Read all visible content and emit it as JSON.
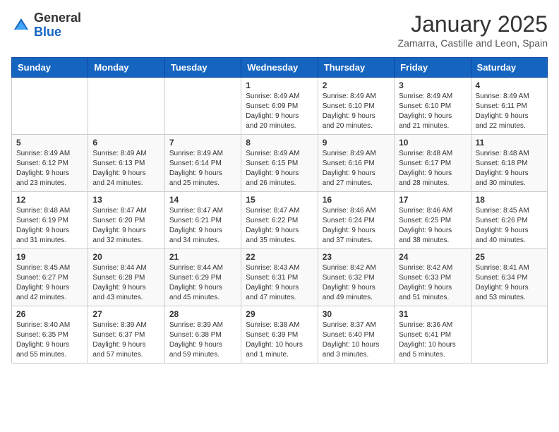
{
  "logo": {
    "general": "General",
    "blue": "Blue"
  },
  "header": {
    "month": "January 2025",
    "location": "Zamarra, Castille and Leon, Spain"
  },
  "weekdays": [
    "Sunday",
    "Monday",
    "Tuesday",
    "Wednesday",
    "Thursday",
    "Friday",
    "Saturday"
  ],
  "weeks": [
    [
      {
        "day": "",
        "info": ""
      },
      {
        "day": "",
        "info": ""
      },
      {
        "day": "",
        "info": ""
      },
      {
        "day": "1",
        "info": "Sunrise: 8:49 AM\nSunset: 6:09 PM\nDaylight: 9 hours\nand 20 minutes."
      },
      {
        "day": "2",
        "info": "Sunrise: 8:49 AM\nSunset: 6:10 PM\nDaylight: 9 hours\nand 20 minutes."
      },
      {
        "day": "3",
        "info": "Sunrise: 8:49 AM\nSunset: 6:10 PM\nDaylight: 9 hours\nand 21 minutes."
      },
      {
        "day": "4",
        "info": "Sunrise: 8:49 AM\nSunset: 6:11 PM\nDaylight: 9 hours\nand 22 minutes."
      }
    ],
    [
      {
        "day": "5",
        "info": "Sunrise: 8:49 AM\nSunset: 6:12 PM\nDaylight: 9 hours\nand 23 minutes."
      },
      {
        "day": "6",
        "info": "Sunrise: 8:49 AM\nSunset: 6:13 PM\nDaylight: 9 hours\nand 24 minutes."
      },
      {
        "day": "7",
        "info": "Sunrise: 8:49 AM\nSunset: 6:14 PM\nDaylight: 9 hours\nand 25 minutes."
      },
      {
        "day": "8",
        "info": "Sunrise: 8:49 AM\nSunset: 6:15 PM\nDaylight: 9 hours\nand 26 minutes."
      },
      {
        "day": "9",
        "info": "Sunrise: 8:49 AM\nSunset: 6:16 PM\nDaylight: 9 hours\nand 27 minutes."
      },
      {
        "day": "10",
        "info": "Sunrise: 8:48 AM\nSunset: 6:17 PM\nDaylight: 9 hours\nand 28 minutes."
      },
      {
        "day": "11",
        "info": "Sunrise: 8:48 AM\nSunset: 6:18 PM\nDaylight: 9 hours\nand 30 minutes."
      }
    ],
    [
      {
        "day": "12",
        "info": "Sunrise: 8:48 AM\nSunset: 6:19 PM\nDaylight: 9 hours\nand 31 minutes."
      },
      {
        "day": "13",
        "info": "Sunrise: 8:47 AM\nSunset: 6:20 PM\nDaylight: 9 hours\nand 32 minutes."
      },
      {
        "day": "14",
        "info": "Sunrise: 8:47 AM\nSunset: 6:21 PM\nDaylight: 9 hours\nand 34 minutes."
      },
      {
        "day": "15",
        "info": "Sunrise: 8:47 AM\nSunset: 6:22 PM\nDaylight: 9 hours\nand 35 minutes."
      },
      {
        "day": "16",
        "info": "Sunrise: 8:46 AM\nSunset: 6:24 PM\nDaylight: 9 hours\nand 37 minutes."
      },
      {
        "day": "17",
        "info": "Sunrise: 8:46 AM\nSunset: 6:25 PM\nDaylight: 9 hours\nand 38 minutes."
      },
      {
        "day": "18",
        "info": "Sunrise: 8:45 AM\nSunset: 6:26 PM\nDaylight: 9 hours\nand 40 minutes."
      }
    ],
    [
      {
        "day": "19",
        "info": "Sunrise: 8:45 AM\nSunset: 6:27 PM\nDaylight: 9 hours\nand 42 minutes."
      },
      {
        "day": "20",
        "info": "Sunrise: 8:44 AM\nSunset: 6:28 PM\nDaylight: 9 hours\nand 43 minutes."
      },
      {
        "day": "21",
        "info": "Sunrise: 8:44 AM\nSunset: 6:29 PM\nDaylight: 9 hours\nand 45 minutes."
      },
      {
        "day": "22",
        "info": "Sunrise: 8:43 AM\nSunset: 6:31 PM\nDaylight: 9 hours\nand 47 minutes."
      },
      {
        "day": "23",
        "info": "Sunrise: 8:42 AM\nSunset: 6:32 PM\nDaylight: 9 hours\nand 49 minutes."
      },
      {
        "day": "24",
        "info": "Sunrise: 8:42 AM\nSunset: 6:33 PM\nDaylight: 9 hours\nand 51 minutes."
      },
      {
        "day": "25",
        "info": "Sunrise: 8:41 AM\nSunset: 6:34 PM\nDaylight: 9 hours\nand 53 minutes."
      }
    ],
    [
      {
        "day": "26",
        "info": "Sunrise: 8:40 AM\nSunset: 6:35 PM\nDaylight: 9 hours\nand 55 minutes."
      },
      {
        "day": "27",
        "info": "Sunrise: 8:39 AM\nSunset: 6:37 PM\nDaylight: 9 hours\nand 57 minutes."
      },
      {
        "day": "28",
        "info": "Sunrise: 8:39 AM\nSunset: 6:38 PM\nDaylight: 9 hours\nand 59 minutes."
      },
      {
        "day": "29",
        "info": "Sunrise: 8:38 AM\nSunset: 6:39 PM\nDaylight: 10 hours\nand 1 minute."
      },
      {
        "day": "30",
        "info": "Sunrise: 8:37 AM\nSunset: 6:40 PM\nDaylight: 10 hours\nand 3 minutes."
      },
      {
        "day": "31",
        "info": "Sunrise: 8:36 AM\nSunset: 6:41 PM\nDaylight: 10 hours\nand 5 minutes."
      },
      {
        "day": "",
        "info": ""
      }
    ]
  ]
}
